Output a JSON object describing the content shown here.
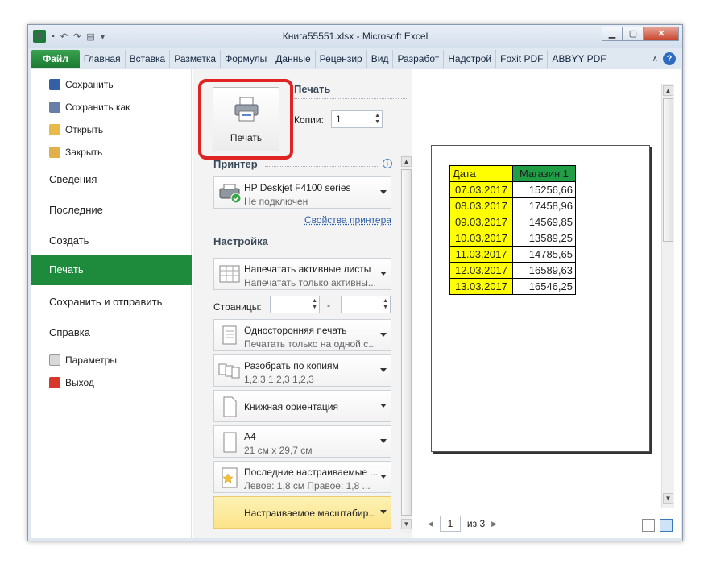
{
  "window": {
    "title": "Книга55551.xlsx  -  Microsoft Excel",
    "controls": {
      "minimize": "▁",
      "maximize": "▢",
      "close": "✕"
    }
  },
  "ribbon": {
    "tabs": [
      "Файл",
      "Главная",
      "Вставка",
      "Разметка",
      "Формулы",
      "Данные",
      "Рецензир",
      "Вид",
      "Разработ",
      "Надстрой",
      "Foxit PDF",
      "ABBYY PDF"
    ],
    "help": "?"
  },
  "backstage": {
    "small_items": [
      "Сохранить",
      "Сохранить как",
      "Открыть",
      "Закрыть"
    ],
    "big_items": [
      "Сведения",
      "Последние",
      "Создать",
      "Печать",
      "Сохранить и отправить",
      "Справка"
    ],
    "bottom_items": [
      "Параметры",
      "Выход"
    ],
    "active": "Печать"
  },
  "print": {
    "button_label": "Печать",
    "header": "Печать",
    "copies_label": "Копии:",
    "copies_value": "1",
    "printer_header": "Принтер",
    "printer_name": "HP Deskjet F4100 series",
    "printer_status": "Не подключен",
    "printer_props": "Свойства принтера",
    "settings_header": "Настройка",
    "what": {
      "l1": "Напечатать активные листы",
      "l2": "Напечатать только активны..."
    },
    "pages_label": "Страницы:",
    "pages_sep": "-",
    "sides": {
      "l1": "Односторонняя печать",
      "l2": "Печатать только на одной с..."
    },
    "collate": {
      "l1": "Разобрать по копиям",
      "l2": "1,2,3    1,2,3    1,2,3"
    },
    "orientation": {
      "l1": "Книжная ориентация"
    },
    "paper": {
      "l1": "A4",
      "l2": "21 см x 29,7 см"
    },
    "margins": {
      "l1": "Последние настраиваемые ...",
      "l2": "Левое: 1,8 см    Правое: 1,8 ..."
    },
    "scaling": {
      "l1": "Настраиваемое масштабир..."
    }
  },
  "preview": {
    "page_value": "1",
    "page_of": "из 3",
    "table": {
      "headers": [
        "Дата",
        "Магазин 1"
      ],
      "rows": [
        [
          "07.03.2017",
          "15256,66"
        ],
        [
          "08.03.2017",
          "17458,96"
        ],
        [
          "09.03.2017",
          "14569,85"
        ],
        [
          "10.03.2017",
          "13589,25"
        ],
        [
          "11.03.2017",
          "14785,65"
        ],
        [
          "12.03.2017",
          "16589,63"
        ],
        [
          "13.03.2017",
          "16546,25"
        ]
      ]
    }
  },
  "colors": {
    "file_tab": "#1d7a32",
    "active_nav": "#1d8a3c",
    "highlight_box": "#e02323",
    "date_fill": "#ffff00",
    "header_fill": "#1f9e46"
  }
}
